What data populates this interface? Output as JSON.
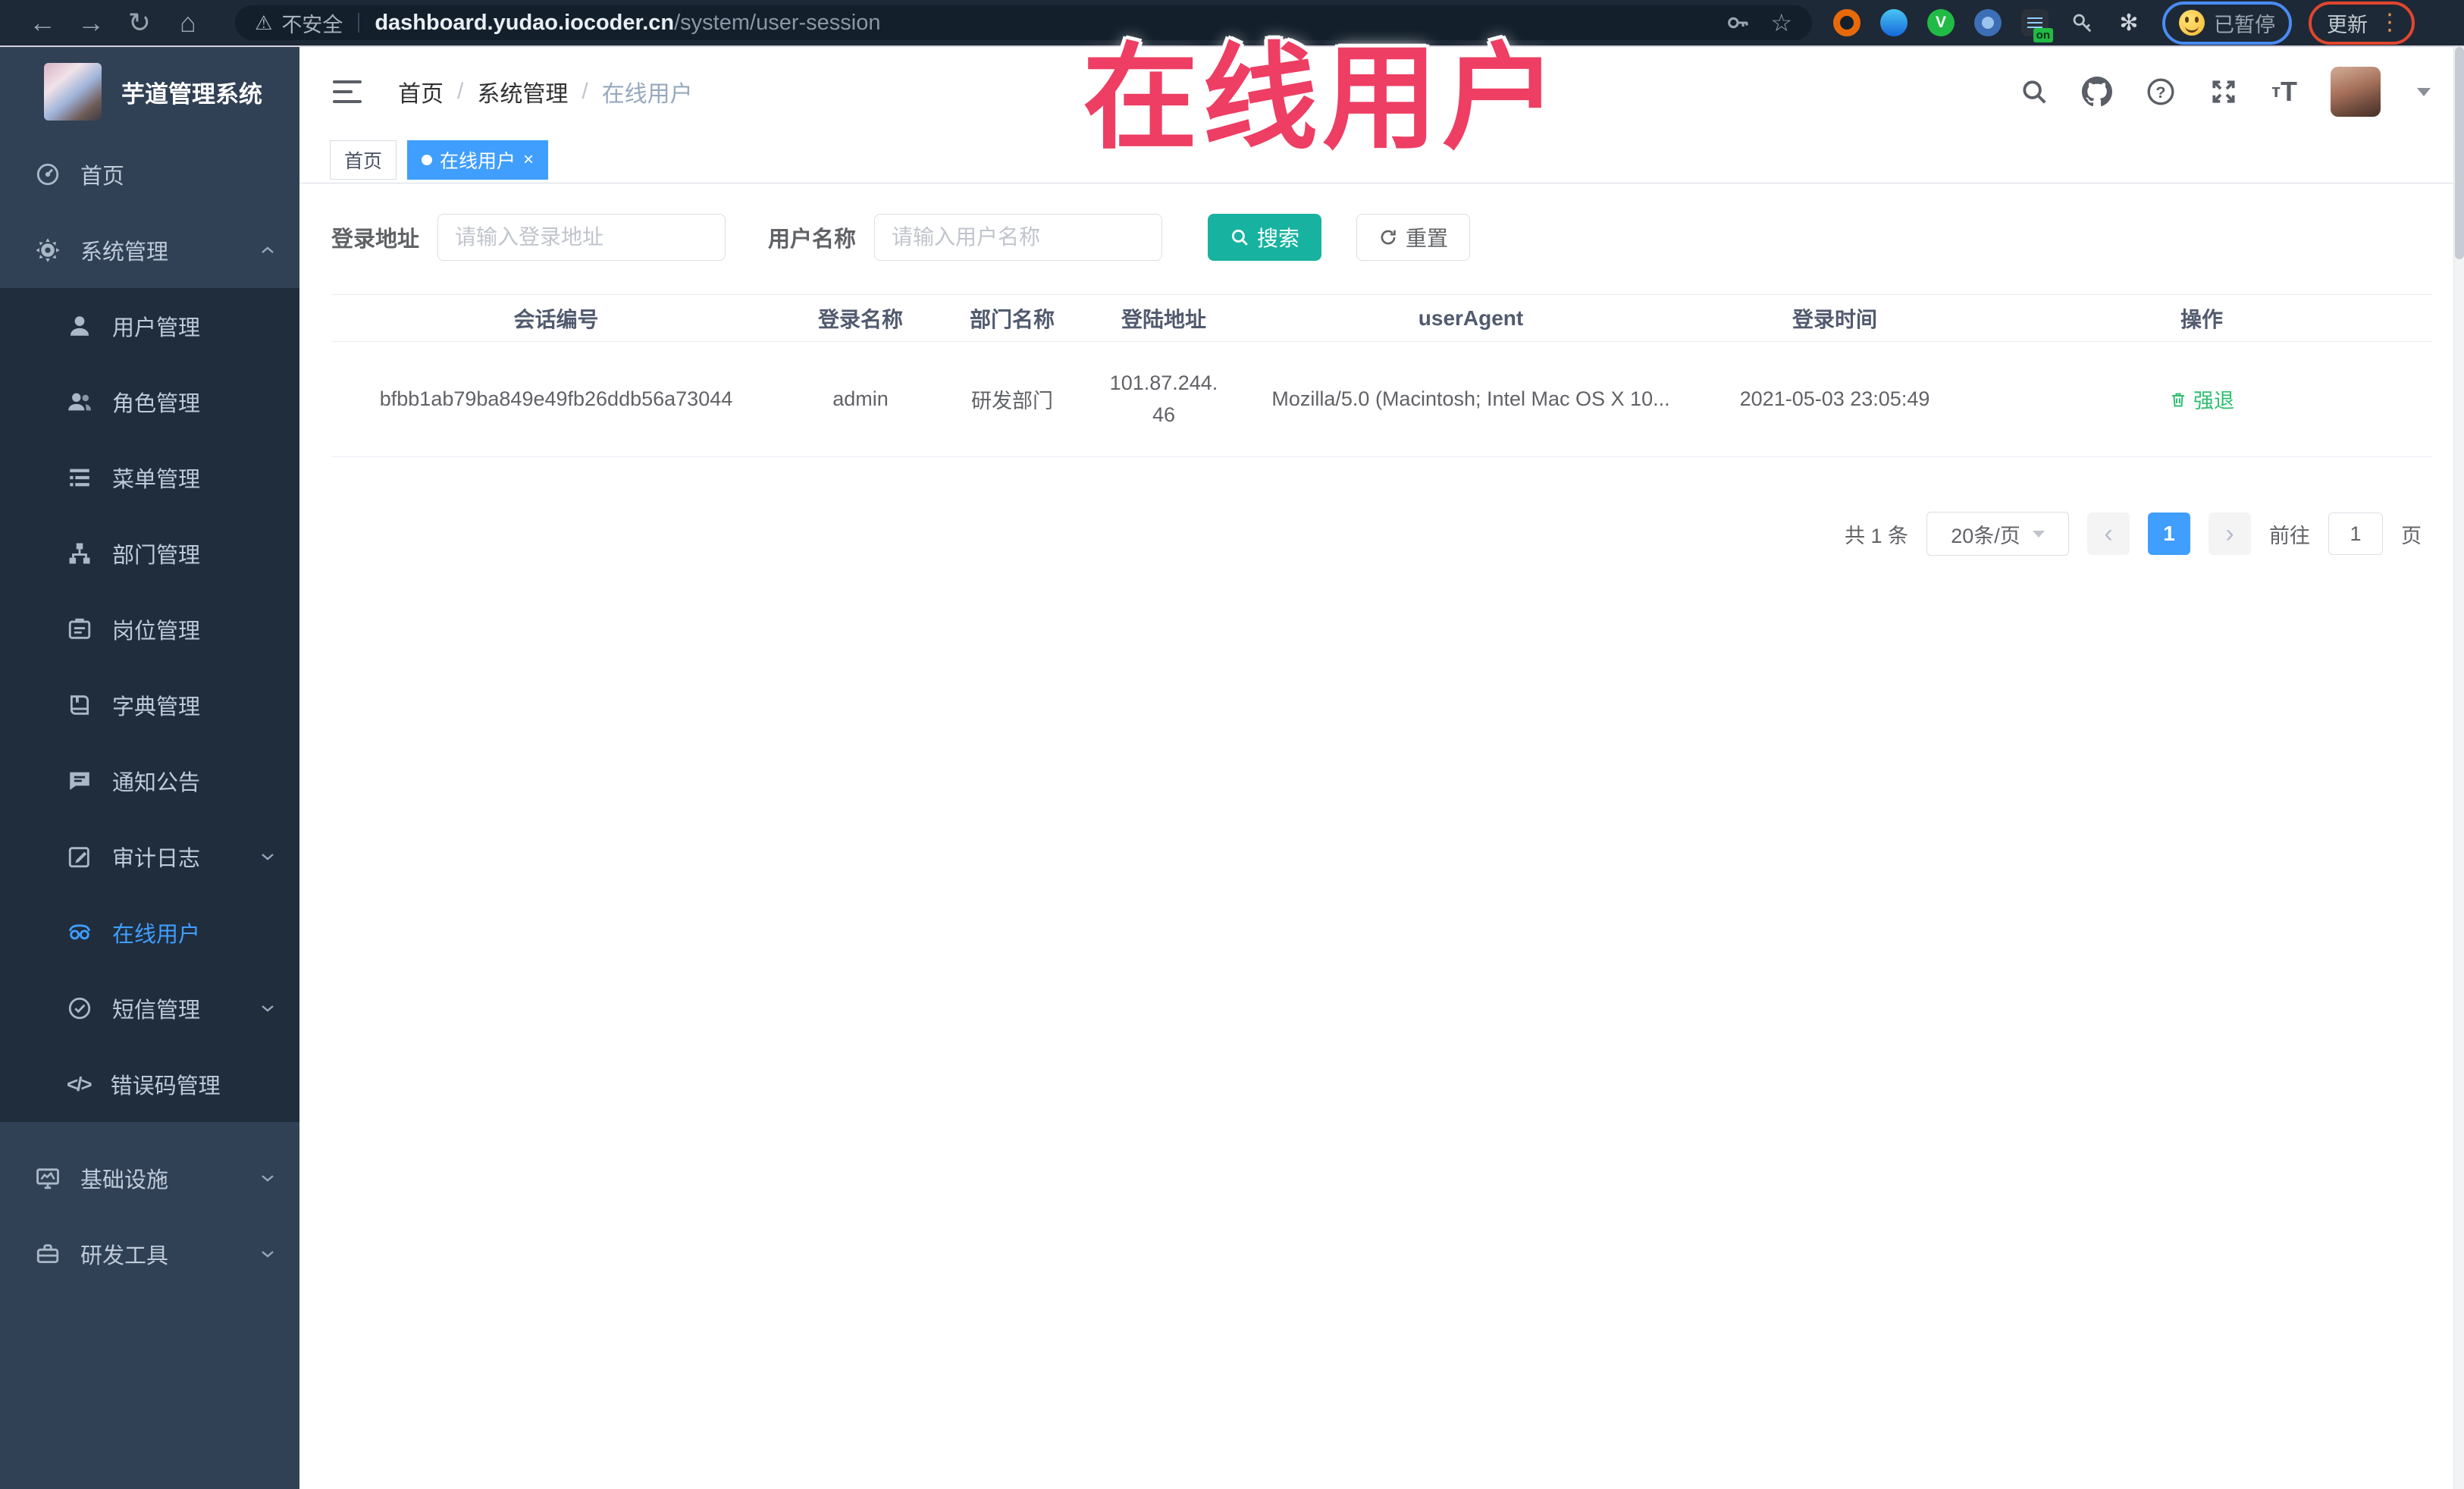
{
  "browser": {
    "security_label": "不安全",
    "url_domain": "dashboard.yudao.iocoder.cn",
    "url_path": "/system/user-session",
    "ext_v_label": "V",
    "ext_on_badge": "on",
    "paused_label": "已暂停",
    "update_label": "更新"
  },
  "watermark": "在线用户",
  "sidebar": {
    "title": "芋道管理系统",
    "items": [
      {
        "label": "首页"
      },
      {
        "label": "系统管理"
      },
      {
        "label": "用户管理"
      },
      {
        "label": "角色管理"
      },
      {
        "label": "菜单管理"
      },
      {
        "label": "部门管理"
      },
      {
        "label": "岗位管理"
      },
      {
        "label": "字典管理"
      },
      {
        "label": "通知公告"
      },
      {
        "label": "审计日志"
      },
      {
        "label": "在线用户"
      },
      {
        "label": "短信管理"
      },
      {
        "label": "错误码管理"
      },
      {
        "label": "基础设施"
      },
      {
        "label": "研发工具"
      }
    ]
  },
  "breadcrumb": {
    "home": "首页",
    "section": "系统管理",
    "current": "在线用户"
  },
  "tabs": {
    "home": "首页",
    "active": "在线用户"
  },
  "filters": {
    "address_label": "登录地址",
    "address_placeholder": "请输入登录地址",
    "name_label": "用户名称",
    "name_placeholder": "请输入用户名称",
    "search_label": "搜索",
    "reset_label": "重置"
  },
  "table": {
    "headers": [
      "会话编号",
      "登录名称",
      "部门名称",
      "登陆地址",
      "userAgent",
      "登录时间",
      "操作"
    ],
    "row": {
      "session_id": "bfbb1ab79ba849e49fb26ddb56a73044",
      "username": "admin",
      "dept": "研发部门",
      "ip": "101.87.244.46",
      "user_agent": "Mozilla/5.0 (Macintosh; Intel Mac OS X 10...",
      "login_time": "2021-05-03 23:05:49",
      "action_label": "强退"
    }
  },
  "pagination": {
    "total": "共 1 条",
    "page_size": "20条/页",
    "current_page": "1",
    "goto_label": "前往",
    "goto_value": "1",
    "unit_label": "页"
  },
  "icons": {
    "search": "magnifier",
    "github": "octocat",
    "docs": "question-circle",
    "fullscreen": "expand",
    "font_size": "tT",
    "force_logout": "trash"
  },
  "colors": {
    "accent_blue": "#409eff",
    "search_teal": "#18b3a0",
    "action_green": "#2fbf71",
    "watermark_red": "#ee3e63",
    "sidebar_bg": "#304156",
    "submenu_bg": "#1f2d3d",
    "toolbar_bg": "#1d2936"
  }
}
